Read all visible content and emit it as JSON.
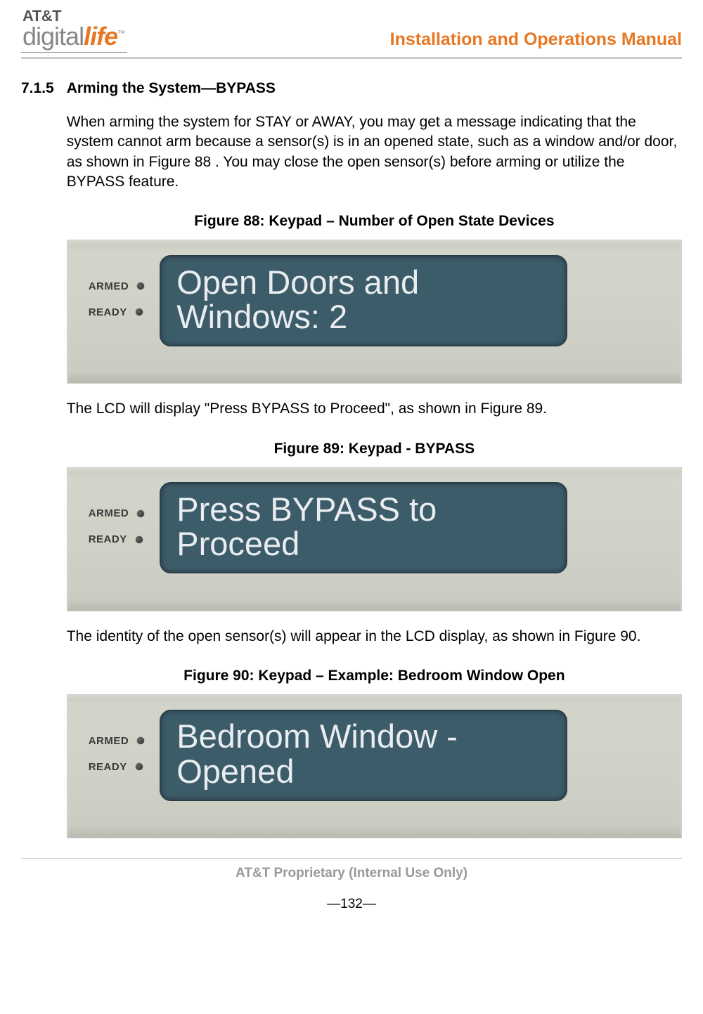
{
  "header": {
    "logo_line1": "AT&T",
    "logo_line2a": "digital",
    "logo_line2b": "life",
    "logo_tm": "™",
    "manual_title": "Installation and Operations Manual"
  },
  "section": {
    "number": "7.1.5",
    "title": "Arming the System—BYPASS"
  },
  "paragraphs": {
    "p1": "When arming the system for STAY or AWAY, you may get a message indicating that the system cannot arm because a sensor(s) is in an opened state, such as a window and/or door, as shown in Figure 88 . You may close the open sensor(s) before arming or utilize the BYPASS feature.",
    "p2": "The LCD will display \"Press BYPASS to Proceed\", as shown in Figure 89.",
    "p3": "The identity of the open sensor(s) will appear in the LCD display, as shown in Figure 90."
  },
  "figures": {
    "f88": {
      "caption": "Figure 88: Keypad – Number of Open State Devices",
      "lcd_text": "Open Doors and Windows: 2"
    },
    "f89": {
      "caption": "Figure 89:  Keypad - BYPASS",
      "lcd_text": "Press BYPASS to Proceed"
    },
    "f90": {
      "caption": "Figure 90: Keypad – Example: Bedroom Window Open",
      "lcd_text": "Bedroom Window - Opened"
    }
  },
  "keypad_labels": {
    "armed": "ARMED",
    "ready": "READY"
  },
  "footer": {
    "proprietary": "AT&T Proprietary (Internal Use Only)",
    "page": "—132—"
  }
}
